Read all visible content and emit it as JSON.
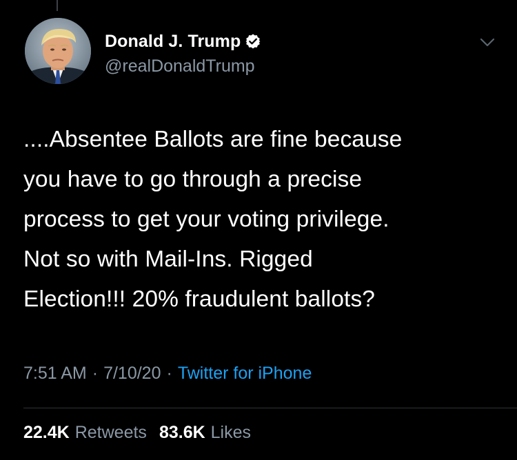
{
  "user": {
    "display_name": "Donald J. Trump",
    "handle": "@realDonaldTrump",
    "verified_icon": "verified-badge-icon",
    "avatar": "profile-photo"
  },
  "menu_icon": "chevron-down-icon",
  "tweet": {
    "text": "....Absentee Ballots are fine because\nyou have to go through a precise\nprocess to get your voting privilege.\nNot so with Mail-Ins. Rigged\nElection!!! 20% fraudulent ballots?"
  },
  "meta": {
    "time": "7:51 AM",
    "separator": "·",
    "date": "7/10/20",
    "source": "Twitter for iPhone"
  },
  "stats": {
    "retweets_count": "22.4K",
    "retweets_label": "Retweets",
    "likes_count": "83.6K",
    "likes_label": "Likes"
  },
  "colors": {
    "background": "#000000",
    "text_primary": "#ffffff",
    "text_secondary": "#8b98a5",
    "link": "#1da1f2",
    "divider": "#2f3336"
  }
}
